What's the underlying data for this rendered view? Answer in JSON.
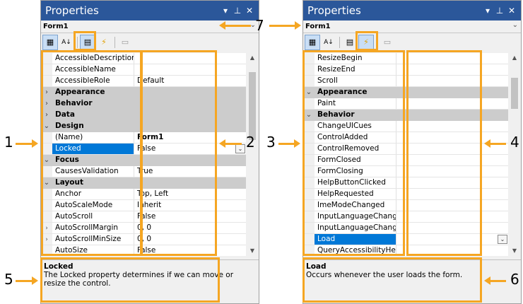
{
  "left": {
    "title": "Properties",
    "object": "Form1",
    "rows": [
      {
        "name": "AccessibleDescription",
        "value": ""
      },
      {
        "name": "AccessibleName",
        "value": ""
      },
      {
        "name": "AccessibleRole",
        "value": "Default"
      },
      {
        "name": "Appearance",
        "category": true,
        "expander": "›"
      },
      {
        "name": "Behavior",
        "category": true,
        "expander": "›"
      },
      {
        "name": "Data",
        "category": true,
        "expander": "›"
      },
      {
        "name": "Design",
        "category": true,
        "expander": "⌄"
      },
      {
        "name": "(Name)",
        "value": "Form1",
        "bold": true
      },
      {
        "name": "Locked",
        "value": "False",
        "selected": true,
        "dropdown": true
      },
      {
        "name": "Focus",
        "category": true,
        "expander": "⌄"
      },
      {
        "name": "CausesValidation",
        "value": "True"
      },
      {
        "name": "Layout",
        "category": true,
        "expander": "⌄"
      },
      {
        "name": "Anchor",
        "value": "Top, Left"
      },
      {
        "name": "AutoScaleMode",
        "value": "Inherit"
      },
      {
        "name": "AutoScroll",
        "value": "False"
      },
      {
        "name": "AutoScrollMargin",
        "value": "0, 0",
        "expander": "›"
      },
      {
        "name": "AutoScrollMinSize",
        "value": "0, 0",
        "expander": "›"
      },
      {
        "name": "AutoSize",
        "value": "False"
      }
    ],
    "desc_title": "Locked",
    "desc_text": "The Locked property determines if we can move or resize the control.",
    "scroll_thumb": {
      "start": 0.05,
      "size": 0.37
    }
  },
  "right": {
    "title": "Properties",
    "object": "Form1",
    "rows": [
      {
        "name": "ResizeBegin",
        "value": ""
      },
      {
        "name": "ResizeEnd",
        "value": ""
      },
      {
        "name": "Scroll",
        "value": ""
      },
      {
        "name": "Appearance",
        "category": true,
        "expander": "⌄"
      },
      {
        "name": "Paint",
        "value": ""
      },
      {
        "name": "Behavior",
        "category": true,
        "expander": "⌄"
      },
      {
        "name": "ChangeUICues",
        "value": ""
      },
      {
        "name": "ControlAdded",
        "value": ""
      },
      {
        "name": "ControlRemoved",
        "value": ""
      },
      {
        "name": "FormClosed",
        "value": ""
      },
      {
        "name": "FormClosing",
        "value": ""
      },
      {
        "name": "HelpButtonClicked",
        "value": ""
      },
      {
        "name": "HelpRequested",
        "value": ""
      },
      {
        "name": "ImeModeChanged",
        "value": ""
      },
      {
        "name": "InputLanguageChanged",
        "value": ""
      },
      {
        "name": "InputLanguageChanging",
        "value": ""
      },
      {
        "name": "Load",
        "value": "",
        "selected": true,
        "dropdown": true
      },
      {
        "name": "QueryAccessibilityHelp",
        "value": ""
      }
    ],
    "desc_title": "Load",
    "desc_text": "Occurs whenever the user loads the form.",
    "scroll_thumb": {
      "start": 0.08,
      "size": 0.17
    }
  },
  "callouts": {
    "n1": "1",
    "n2": "2",
    "n3": "3",
    "n4": "4",
    "n5": "5",
    "n6": "6",
    "n7": "7"
  },
  "colors": {
    "accent": "#f5a623",
    "titlebar": "#2b579a",
    "selection": "#0078d7"
  }
}
